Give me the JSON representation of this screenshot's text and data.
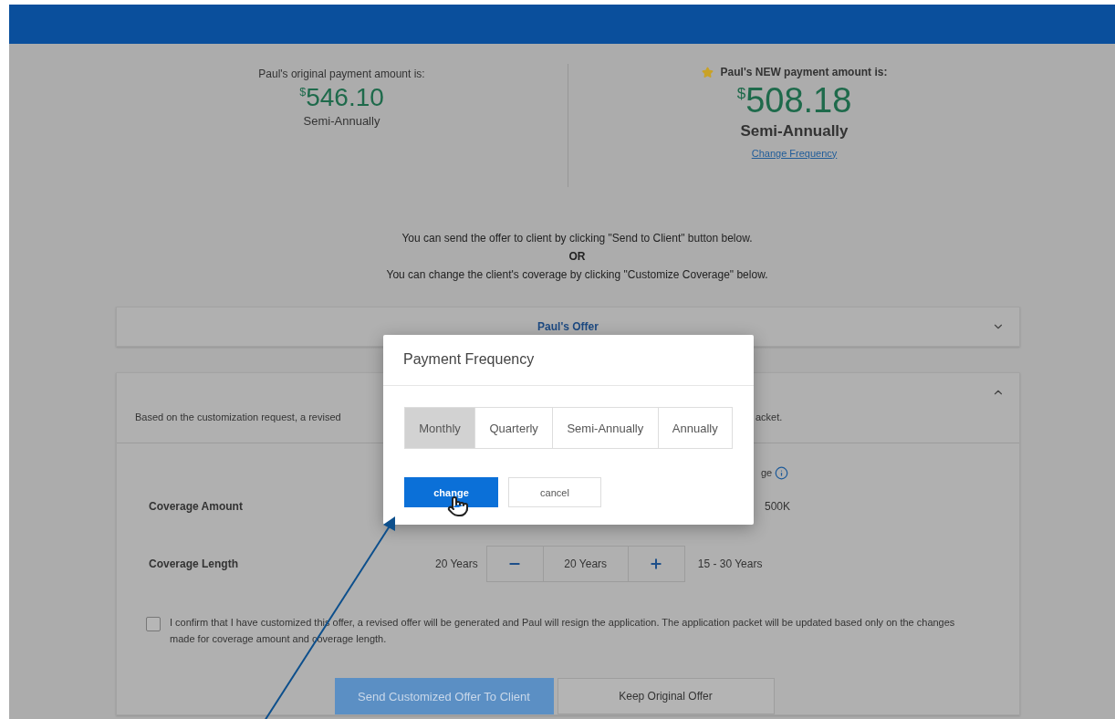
{
  "summary": {
    "original": {
      "label": "Paul's original payment amount is:",
      "currency": "$",
      "amount": "546.10",
      "frequency": "Semi-Annually"
    },
    "new": {
      "label": "Paul's NEW payment amount is:",
      "currency": "$",
      "amount": "508.18",
      "frequency": "Semi-Annually",
      "link": "Change Frequency"
    }
  },
  "instructions": [
    "You can send the offer to client by clicking \"Send to Client\" button below.",
    "OR",
    "You can change the client's coverage by clicking \"Customize Coverage\" below."
  ],
  "offer_panel": {
    "title": "Paul's Offer",
    "expanded": false
  },
  "customize_panel": {
    "expanded": true,
    "description_start": "Based on the customization request, a revised",
    "description_end": "acket.",
    "range_heading": "ge",
    "rows": [
      {
        "kind": "amount",
        "label": "Coverage Amount",
        "range": "500K"
      },
      {
        "kind": "stepper",
        "label": "Coverage Length",
        "current": "20 Years",
        "value": "20 Years",
        "range": "15 - 30 Years"
      }
    ],
    "confirm": {
      "checked": false,
      "text": "I confirm that I have customized this offer, a revised offer will be generated and Paul will resign the application. The application packet will be updated based only on the changes made for coverage amount and coverage length."
    },
    "buttons": [
      {
        "label": "Send Customized Offer To Client",
        "kind": "primary"
      },
      {
        "label": "Keep Original Offer",
        "kind": "secondary"
      }
    ]
  },
  "modal": {
    "title": "Payment Frequency",
    "options": [
      {
        "label": "Monthly",
        "selected": true
      },
      {
        "label": "Quarterly",
        "selected": false
      },
      {
        "label": "Semi-Annually",
        "selected": false
      },
      {
        "label": "Annually",
        "selected": false
      }
    ],
    "buttons": [
      {
        "label": "change",
        "kind": "primary"
      },
      {
        "label": "cancel",
        "kind": "secondary"
      }
    ]
  }
}
